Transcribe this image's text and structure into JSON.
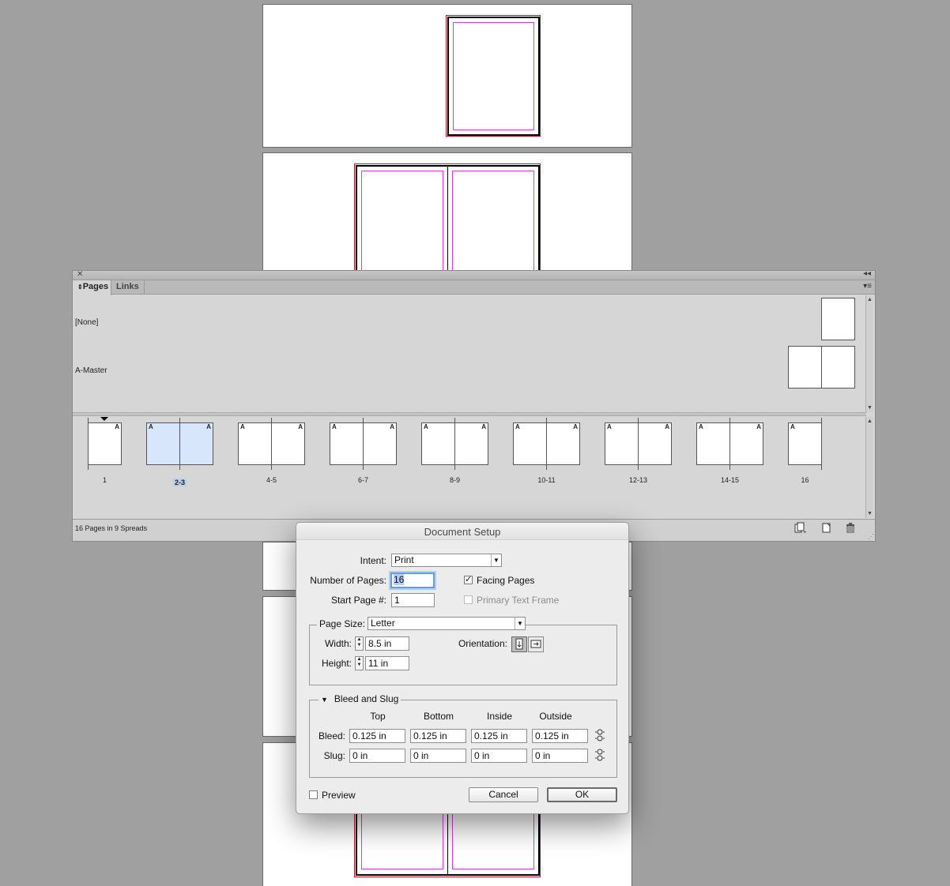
{
  "pages_panel": {
    "tabs": [
      {
        "label": "Pages",
        "active": true
      },
      {
        "label": "Links",
        "active": false
      }
    ],
    "masters": [
      {
        "label": "[None]"
      },
      {
        "label": "A-Master"
      }
    ],
    "spreads": [
      {
        "label": "1",
        "prefixes": [
          "A"
        ],
        "selected": false
      },
      {
        "label": "2-3",
        "prefixes": [
          "A",
          "A"
        ],
        "selected": true
      },
      {
        "label": "4-5",
        "prefixes": [
          "A",
          "A"
        ],
        "selected": false
      },
      {
        "label": "6-7",
        "prefixes": [
          "A",
          "A"
        ],
        "selected": false
      },
      {
        "label": "8-9",
        "prefixes": [
          "A",
          "A"
        ],
        "selected": false
      },
      {
        "label": "10-11",
        "prefixes": [
          "A",
          "A"
        ],
        "selected": false
      },
      {
        "label": "12-13",
        "prefixes": [
          "A",
          "A"
        ],
        "selected": false
      },
      {
        "label": "14-15",
        "prefixes": [
          "A",
          "A"
        ],
        "selected": false
      },
      {
        "label": "16",
        "prefixes": [
          "A"
        ],
        "selected": false
      }
    ],
    "status": "16 Pages in 9 Spreads",
    "footer_icons": [
      "edit-page-size-icon",
      "new-page-icon",
      "delete-page-icon"
    ]
  },
  "dialog": {
    "title": "Document Setup",
    "intent_label": "Intent:",
    "intent_value": "Print",
    "num_pages_label": "Number of Pages:",
    "num_pages_value": "16",
    "start_page_label": "Start Page #:",
    "start_page_value": "1",
    "facing_pages_label": "Facing Pages",
    "facing_pages_checked": true,
    "primary_text_frame_label": "Primary Text Frame",
    "primary_text_frame_checked": false,
    "page_size_label": "Page Size:",
    "page_size_value": "Letter",
    "width_label": "Width:",
    "width_value": "8.5 in",
    "height_label": "Height:",
    "height_value": "11 in",
    "orientation_label": "Orientation:",
    "orientation_selected": "portrait",
    "bleed_slug_title": "Bleed and Slug",
    "columns": [
      "Top",
      "Bottom",
      "Inside",
      "Outside"
    ],
    "bleed_label": "Bleed:",
    "bleed_values": [
      "0.125 in",
      "0.125 in",
      "0.125 in",
      "0.125 in"
    ],
    "slug_label": "Slug:",
    "slug_values": [
      "0 in",
      "0 in",
      "0 in",
      "0 in"
    ],
    "preview_label": "Preview",
    "preview_checked": false,
    "cancel_label": "Cancel",
    "ok_label": "OK"
  },
  "colors": {
    "pasteboard": "#a0a0a0",
    "margin_guide": "#d93fd9",
    "bleed_guide": "#c8102e",
    "selection": "#d8e6fb"
  }
}
